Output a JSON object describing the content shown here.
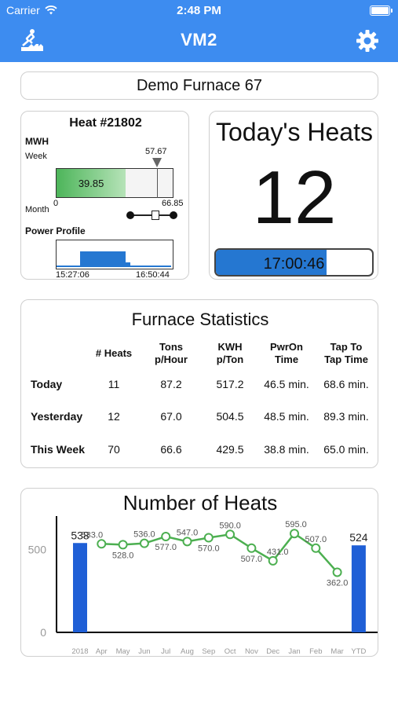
{
  "status_bar": {
    "carrier": "Carrier",
    "time": "2:48 PM"
  },
  "nav": {
    "title": "VM2",
    "left_icon": "furnace-icon",
    "right_icon": "gear-icon"
  },
  "furnace": {
    "name": "Demo Furnace 67"
  },
  "heat": {
    "title": "Heat #21802",
    "mwh_label": "MWH",
    "week_label": "Week",
    "month_label": "Month",
    "week_value": "57.67",
    "current_value": "39.85",
    "min_label": "0",
    "max_label": "66.85",
    "current_fraction": 0.596,
    "week_fraction": 0.863,
    "power_profile_label": "Power Profile",
    "start_time": "15:27:06",
    "end_time": "16:50:44"
  },
  "today": {
    "title": "Today's Heats",
    "count": "12",
    "elapsed": "17:00:46",
    "elapsed_fraction": 0.71
  },
  "stats": {
    "title": "Furnace Statistics",
    "columns": [
      "",
      "# Heats",
      "Tons\np/Hour",
      "KWH\np/Ton",
      "PwrOn\nTime",
      "Tap To\nTap Time"
    ],
    "rows": [
      {
        "label": "Today",
        "heats": "11",
        "tons": "87.2",
        "kwh": "517.2",
        "pwron": "46.5 min.",
        "tap": "68.6 min."
      },
      {
        "label": "Yesterday",
        "heats": "12",
        "tons": "67.0",
        "kwh": "504.5",
        "pwron": "48.5 min.",
        "tap": "89.3 min."
      },
      {
        "label": "This Week",
        "heats": "70",
        "tons": "66.6",
        "kwh": "429.5",
        "pwron": "38.8 min.",
        "tap": "65.0 min."
      }
    ]
  },
  "chart_data": {
    "type": "bar",
    "title": "Number of Heats",
    "categories": [
      "2018",
      "Apr",
      "May",
      "Jun",
      "Jul",
      "Aug",
      "Sep",
      "Oct",
      "Nov",
      "Dec",
      "Jan",
      "Feb",
      "Mar",
      "YTD"
    ],
    "yticks": [
      "0",
      "500"
    ],
    "ylim": [
      0,
      700
    ],
    "bars": [
      {
        "category": "2018",
        "value": 538,
        "label": "538"
      },
      {
        "category": "YTD",
        "value": 524,
        "label": "524"
      }
    ],
    "series": [
      {
        "type": "line",
        "categories": [
          "Apr",
          "May",
          "Jun",
          "Jul",
          "Aug",
          "Sep",
          "Oct",
          "Nov",
          "Dec",
          "Jan",
          "Feb",
          "Mar"
        ],
        "values": [
          533.0,
          528.0,
          536.0,
          577.0,
          547.0,
          570.0,
          590.0,
          507.0,
          431.0,
          595.0,
          507.0,
          362.0
        ],
        "labels": [
          "533.0",
          "528.0",
          "536.0",
          "577.0",
          "547.0",
          "570.0",
          "590.0",
          "507.0",
          "431.0",
          "595.0",
          "507.0",
          "362.0"
        ]
      }
    ],
    "colors": {
      "bar": "#1f5fd6",
      "line": "#4caf50"
    }
  }
}
